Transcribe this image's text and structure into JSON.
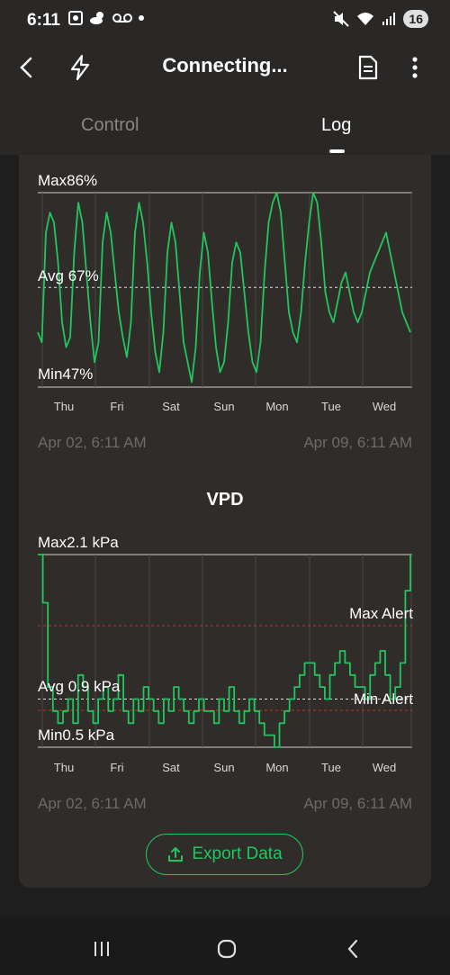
{
  "status": {
    "time": "6:11",
    "battery": "16",
    "icons_left": [
      "screenshot-icon",
      "weather-icon",
      "voicemail-icon",
      "dot-icon"
    ],
    "icons_right": [
      "mute-icon",
      "wifi-icon",
      "signal-icon"
    ]
  },
  "appbar": {
    "title": "Connecting...",
    "icons": [
      "back-icon",
      "lightning-icon",
      "document-icon",
      "more-icon"
    ]
  },
  "tabs": [
    {
      "label": "Control",
      "active": false
    },
    {
      "label": "Log",
      "active": true
    }
  ],
  "humidity_chart": {
    "max_label": "Max86%",
    "avg_label": "Avg 67%",
    "min_label": "Min47%",
    "days": [
      "Thu",
      "Fri",
      "Sat",
      "Sun",
      "Mon",
      "Tue",
      "Wed"
    ],
    "start_date": "Apr 02, 6:11 AM",
    "end_date": "Apr 09, 6:11 AM"
  },
  "vpd_chart": {
    "title": "VPD",
    "max_label": "Max2.1 kPa",
    "avg_label": "Avg 0.9 kPa",
    "min_label": "Min0.5 kPa",
    "max_alert_label": "Max Alert",
    "min_alert_label": "Min Alert",
    "days": [
      "Thu",
      "Fri",
      "Sat",
      "Sun",
      "Mon",
      "Tue",
      "Wed"
    ],
    "start_date": "Apr 02, 6:11 AM",
    "end_date": "Apr 09, 6:11 AM"
  },
  "export_button": {
    "label": "Export Data"
  },
  "chart_data": [
    {
      "type": "line",
      "title": "",
      "series": [
        {
          "values": [
            58,
            56,
            78,
            82,
            80,
            72,
            60,
            55,
            57,
            74,
            84,
            80,
            70,
            60,
            52,
            56,
            76,
            82,
            78,
            70,
            62,
            57,
            53,
            60,
            78,
            84,
            80,
            72,
            62,
            54,
            50,
            58,
            74,
            80,
            76,
            66,
            56,
            52,
            48,
            55,
            70,
            78,
            74,
            64,
            55,
            50,
            52,
            60,
            72,
            76,
            74,
            66,
            58,
            52,
            50,
            56,
            70,
            80,
            84,
            86,
            82,
            72,
            62,
            58,
            56,
            62,
            72,
            80,
            86,
            84,
            76,
            66,
            62,
            60,
            64,
            68,
            70,
            66,
            62,
            60,
            62,
            66,
            70,
            72,
            74,
            76,
            78,
            74,
            70,
            66,
            62,
            60,
            58
          ]
        }
      ],
      "ylim": [
        47,
        86
      ],
      "stats": {
        "max": 86,
        "avg": 67,
        "min": 47
      }
    },
    {
      "type": "line",
      "title": "VPD",
      "series": [
        {
          "values": [
            2.1,
            1.7,
            1.0,
            0.8,
            0.7,
            0.8,
            0.9,
            0.7,
            1.1,
            1.0,
            0.8,
            0.7,
            0.9,
            1.0,
            0.8,
            0.9,
            1.1,
            0.8,
            0.7,
            0.9,
            0.8,
            1.0,
            0.9,
            0.8,
            0.7,
            0.9,
            0.8,
            1.0,
            0.9,
            0.8,
            0.7,
            0.8,
            0.9,
            0.8,
            0.8,
            0.7,
            0.9,
            0.8,
            1.0,
            0.8,
            0.7,
            0.8,
            0.9,
            0.8,
            0.7,
            0.6,
            0.6,
            0.5,
            0.7,
            0.8,
            0.9,
            1.0,
            1.1,
            1.2,
            1.2,
            1.1,
            1.0,
            0.9,
            1.1,
            1.2,
            1.3,
            1.2,
            1.1,
            1.0,
            1.0,
            0.9,
            1.1,
            1.2,
            1.3,
            1.1,
            0.9,
            1.0,
            1.2,
            1.8,
            2.1
          ]
        }
      ],
      "ylim": [
        0.5,
        2.1
      ],
      "stats": {
        "max": 2.1,
        "avg": 0.9,
        "min": 0.5
      }
    }
  ],
  "colors": {
    "accent": "#22c55e",
    "alert": "#c0392b",
    "card": "#2f2c2a",
    "bar": "#2a2827"
  }
}
